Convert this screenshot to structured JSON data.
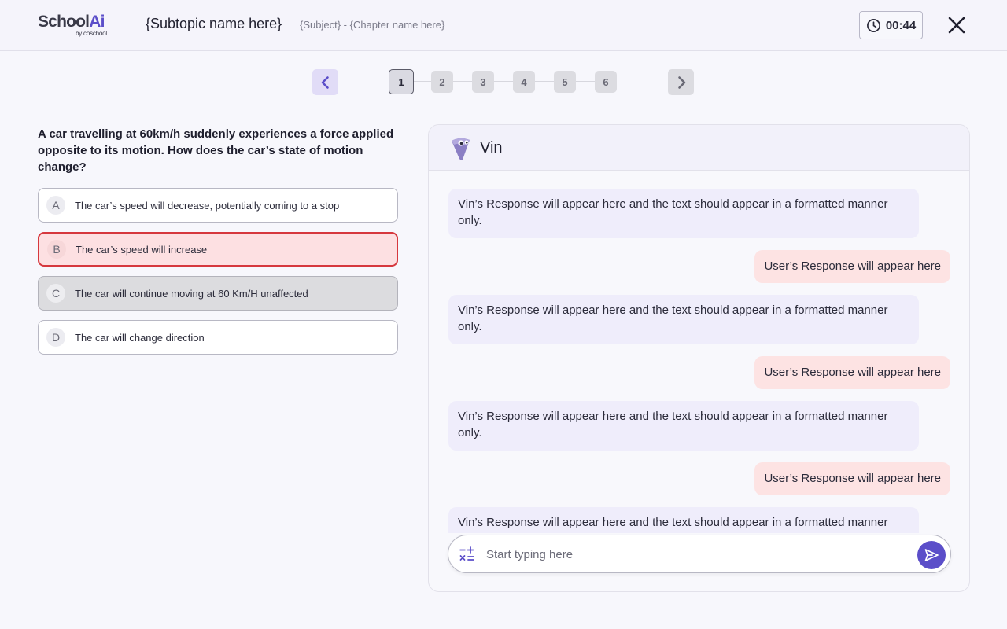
{
  "header": {
    "logo_main": "School",
    "logo_accent": "Ai",
    "logo_sub": "by coschool",
    "subtopic": "{Subtopic name here}",
    "breadcrumb": "{Subject} - {Chapter name here}",
    "timer": "00:44",
    "icons": {
      "timer": "clock-icon",
      "close": "close-icon"
    }
  },
  "pager": {
    "pages": [
      "1",
      "2",
      "3",
      "4",
      "5",
      "6"
    ],
    "active_page": "1",
    "prev_icon": "chevron-left-icon",
    "next_icon": "chevron-right-icon"
  },
  "question": {
    "text": "A car travelling at 60km/h suddenly experiences a force applied opposite to its motion. How does the car’s state of motion change?",
    "options": [
      {
        "letter": "A",
        "text": "The car’s speed will decrease, potentially coming to a stop",
        "state": "default"
      },
      {
        "letter": "B",
        "text": "The car’s speed will increase",
        "state": "selected-wrong"
      },
      {
        "letter": "C",
        "text": "The car will continue moving at 60 Km/H unaffected",
        "state": "disabled"
      },
      {
        "letter": "D",
        "text": "The car will change direction",
        "state": "default"
      }
    ]
  },
  "chat": {
    "bot_name": "Vin",
    "bot_avatar": "vin-mascot-icon",
    "messages": [
      {
        "from": "bot",
        "text": "Vin’s Response will appear here and the text should appear in a formatted manner only."
      },
      {
        "from": "user",
        "text": "User’s Response will appear here"
      },
      {
        "from": "bot",
        "text": "Vin’s Response will appear here and the text should appear in a formatted manner only."
      },
      {
        "from": "user",
        "text": "User’s Response will appear here"
      },
      {
        "from": "bot",
        "text": "Vin’s Response will appear here and the text should appear in a formatted manner only."
      },
      {
        "from": "user",
        "text": "User’s Response will appear here"
      },
      {
        "from": "bot",
        "text": "Vin’s Response will appear here and the text should appear in a formatted manner only."
      }
    ],
    "input_placeholder": "Start typing here",
    "input_value": "",
    "math_icon": "math-operators-icon",
    "send_icon": "send-icon"
  },
  "colors": {
    "accent": "#5b4ec9",
    "wrong_bg": "#fde0e2",
    "wrong_border": "#d6383e",
    "bot_bubble": "#efedfb",
    "user_bubble": "#fde3e3"
  }
}
